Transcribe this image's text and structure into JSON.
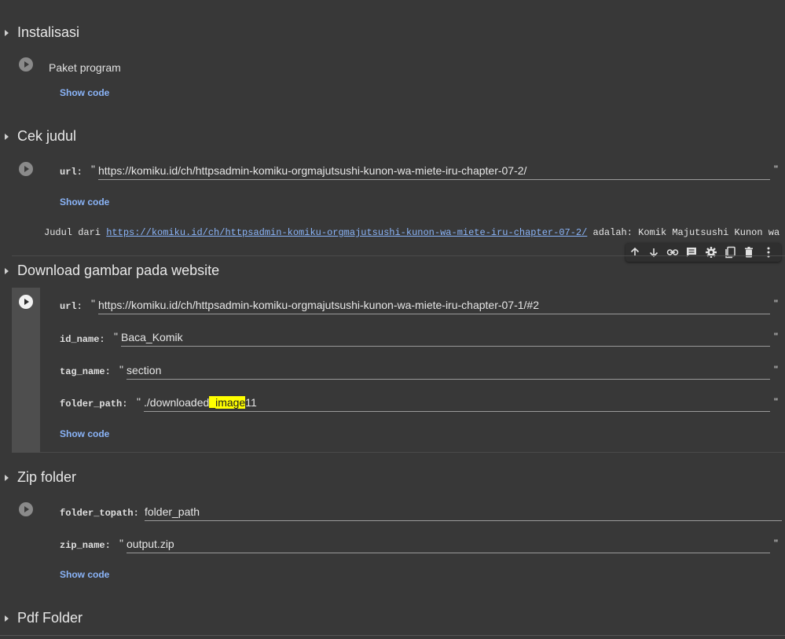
{
  "sections": {
    "instalisasi": {
      "title": "Instalisasi",
      "cell_label": "Paket program",
      "show_code": "Show code"
    },
    "cek_judul": {
      "title": "Cek judul",
      "url_label": "url:",
      "url_value": "https://komiku.id/ch/httpsadmin-komiku-orgmajutsushi-kunon-wa-miete-iru-chapter-07-2/",
      "show_code": "Show code",
      "output_prefix": "Judul dari ",
      "output_link": "https://komiku.id/ch/httpsadmin-komiku-orgmajutsushi-kunon-wa-miete-iru-chapter-07-2/",
      "output_suffix": " adalah: Komik Majutsushi Kunon wa Miete"
    },
    "download": {
      "title": "Download gambar pada website",
      "url_label": "url:",
      "url_value": "https://komiku.id/ch/httpsadmin-komiku-orgmajutsushi-kunon-wa-miete-iru-chapter-07-1/#2",
      "id_label": "id_name:",
      "id_value": "Baca_Komik",
      "tag_label": "tag_name:",
      "tag_value": "section",
      "folder_label": "folder_path:",
      "folder_value_pre": "./downloaded",
      "folder_value_hl": "_image",
      "folder_value_post": "11",
      "show_code": "Show code"
    },
    "zip": {
      "title": "Zip folder",
      "topath_label": "folder_topath:",
      "topath_value": "folder_path",
      "zipname_label": "zip_name:",
      "zipname_value": "output.zip",
      "show_code": "Show code"
    },
    "pdf": {
      "title": "Pdf Folder"
    }
  },
  "quote": "\"",
  "toolbar": [
    "arrow-up-icon",
    "arrow-down-icon",
    "link-icon",
    "comment-icon",
    "gear-icon",
    "mirror-cell-icon",
    "trash-icon",
    "more-vert-icon"
  ]
}
